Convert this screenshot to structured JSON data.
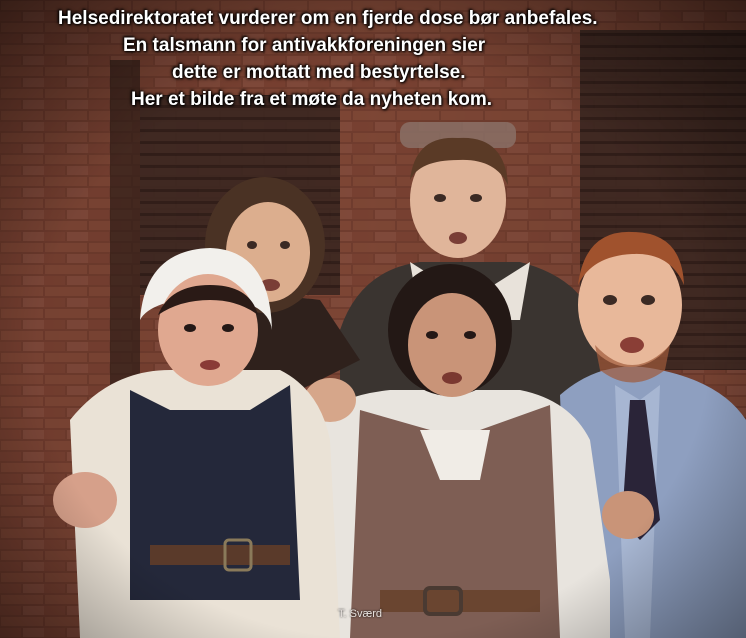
{
  "caption": {
    "lines": [
      "Helsedirektoratet vurderer om en fjerde dose bør anbefales.",
      "En talsmann for antivakkforeningen sier",
      "dette er mottatt med bestyrtelse.",
      "Her et bilde fra et møte da nyheten kom."
    ],
    "color": "#ffffff"
  },
  "watermark": {
    "text": "T. Sværd"
  },
  "scene": {
    "wall_color": "#7a4030",
    "blind_color": "#3a2620",
    "people": [
      "woman-in-bonnet",
      "curly-haired-man",
      "man-in-vest",
      "woman-in-brown-vest",
      "man-in-tie"
    ]
  }
}
